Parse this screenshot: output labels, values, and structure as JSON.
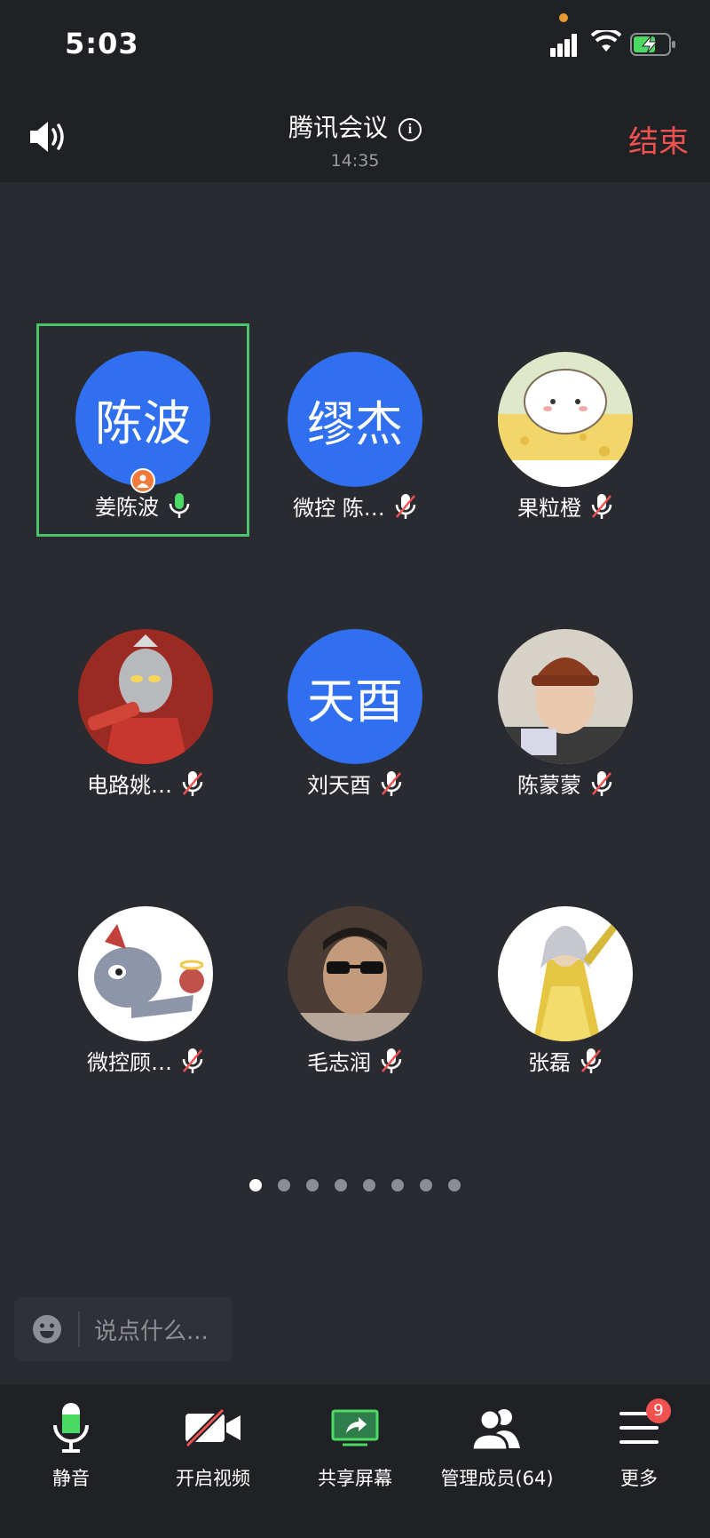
{
  "status_bar": {
    "time": "5:03"
  },
  "header": {
    "title": "腾讯会议",
    "duration": "14:35",
    "end_label": "结束"
  },
  "participants": [
    {
      "name": "姜陈波",
      "avatar_text": "陈波",
      "avatar_kind": "text",
      "muted": false,
      "host": true,
      "active": true
    },
    {
      "name": "微控 陈…",
      "avatar_text": "缪杰",
      "avatar_kind": "text",
      "muted": true,
      "host": false,
      "active": false
    },
    {
      "name": "果粒橙",
      "avatar_text": "",
      "avatar_kind": "cartoon-sheep",
      "muted": true,
      "host": false,
      "active": false
    },
    {
      "name": "电路姚…",
      "avatar_text": "",
      "avatar_kind": "red-hero",
      "muted": true,
      "host": false,
      "active": false
    },
    {
      "name": "刘天酉",
      "avatar_text": "天酉",
      "avatar_kind": "text",
      "muted": true,
      "host": false,
      "active": false
    },
    {
      "name": "陈蒙蒙",
      "avatar_text": "",
      "avatar_kind": "photo-beanie",
      "muted": true,
      "host": false,
      "active": false
    },
    {
      "name": "微控顾…",
      "avatar_text": "",
      "avatar_kind": "cartoon-cat",
      "muted": true,
      "host": false,
      "active": false
    },
    {
      "name": "毛志润",
      "avatar_text": "",
      "avatar_kind": "photo-sunglasses",
      "muted": true,
      "host": false,
      "active": false
    },
    {
      "name": "张磊",
      "avatar_text": "",
      "avatar_kind": "golden-warrior",
      "muted": true,
      "host": false,
      "active": false
    }
  ],
  "pager": {
    "total": 8,
    "current": 1
  },
  "chat": {
    "placeholder": "说点什么..."
  },
  "toolbar": {
    "mute_label": "静音",
    "video_label": "开启视频",
    "share_label": "共享屏幕",
    "members_label": "管理成员(64)",
    "more_label": "更多",
    "more_badge": "9"
  },
  "colors": {
    "background": "#292b30",
    "bar": "#202124",
    "accent_blue": "#2f6ff0",
    "active_green": "#4cc26a",
    "end_red": "#f0524f"
  }
}
